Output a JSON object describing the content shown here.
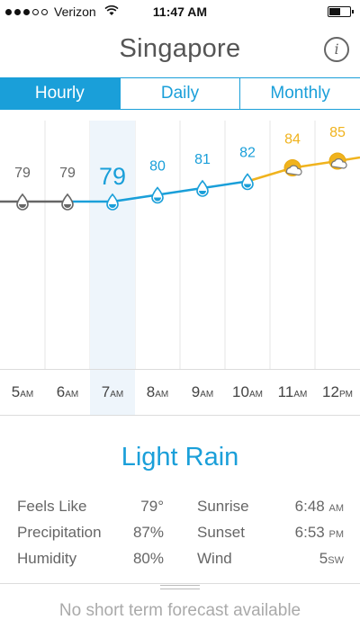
{
  "status": {
    "carrier": "Verizon",
    "time": "11:47 AM",
    "signal_dots": 5,
    "signal_filled": 3,
    "battery_level": 0.55
  },
  "header": {
    "city": "Singapore",
    "info_icon": "info-icon"
  },
  "tabs": [
    {
      "label": "Hourly",
      "active": true
    },
    {
      "label": "Daily",
      "active": false
    },
    {
      "label": "Monthly",
      "active": false
    }
  ],
  "hourly": {
    "selected_index": 2,
    "items": [
      {
        "hour": "5",
        "suffix": "AM",
        "temp": "79",
        "icon": "raindrop-icon"
      },
      {
        "hour": "6",
        "suffix": "AM",
        "temp": "79",
        "icon": "raindrop-icon"
      },
      {
        "hour": "7",
        "suffix": "AM",
        "temp": "79",
        "icon": "raindrop-icon"
      },
      {
        "hour": "8",
        "suffix": "AM",
        "temp": "80",
        "icon": "raindrop-icon"
      },
      {
        "hour": "9",
        "suffix": "AM",
        "temp": "81",
        "icon": "raindrop-icon"
      },
      {
        "hour": "10",
        "suffix": "AM",
        "temp": "82",
        "icon": "raindrop-icon"
      },
      {
        "hour": "11",
        "suffix": "AM",
        "temp": "84",
        "icon": "partly-cloudy-icon"
      },
      {
        "hour": "12",
        "suffix": "PM",
        "temp": "85",
        "icon": "partly-cloudy-icon"
      }
    ],
    "colors": {
      "past": "#666666",
      "rain": "#1a9fd9",
      "sun": "#f0b31e"
    }
  },
  "condition": "Light Rain",
  "details": {
    "feels_like_label": "Feels Like",
    "feels_like_value": "79°",
    "precipitation_label": "Precipitation",
    "precipitation_value": "87%",
    "humidity_label": "Humidity",
    "humidity_value": "80%",
    "sunrise_label": "Sunrise",
    "sunrise_value": "6:48",
    "sunrise_suffix": "AM",
    "sunset_label": "Sunset",
    "sunset_value": "6:53",
    "sunset_suffix": "PM",
    "wind_label": "Wind",
    "wind_value": "5",
    "wind_suffix": "SW"
  },
  "footer": "No short term forecast available"
}
